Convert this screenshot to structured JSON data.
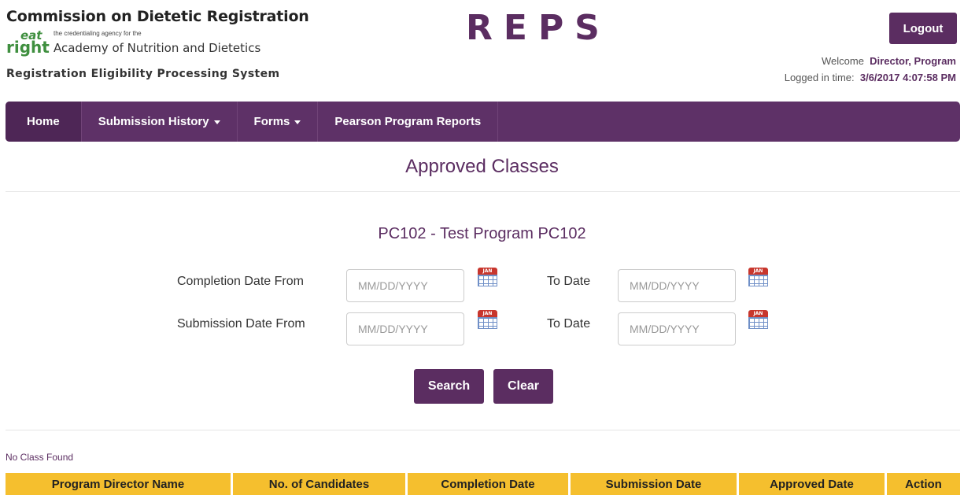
{
  "header": {
    "org_title": "Commission on Dietetic Registration",
    "logo": {
      "eat": "eat",
      "right": "right",
      "tagline": "the credentialing agency for the",
      "academy": "Academy of Nutrition and Dietetics"
    },
    "system_name": "Registration Eligibility Processing System",
    "app_title": "REPS",
    "logout_label": "Logout",
    "welcome_prefix": "Welcome",
    "user_name": "Director, Program",
    "logged_prefix": "Logged in time:",
    "logged_time": "3/6/2017 4:07:58 PM"
  },
  "nav": {
    "items": [
      {
        "label": "Home"
      },
      {
        "label": "Submission History"
      },
      {
        "label": "Forms"
      },
      {
        "label": "Pearson Program Reports"
      }
    ]
  },
  "page": {
    "title": "Approved Classes",
    "program": "PC102 - Test Program PC102"
  },
  "filters": {
    "completion_from_label": "Completion Date From",
    "submission_from_label": "Submission Date From",
    "to_label": "To Date",
    "date_placeholder": "MM/DD/YYYY",
    "calendar_text": "JAN",
    "search_label": "Search",
    "clear_label": "Clear"
  },
  "results": {
    "message": "No Class Found",
    "columns": [
      "Program Director Name",
      "No. of Candidates",
      "Completion Date",
      "Submission Date",
      "Approved Date",
      "Action"
    ]
  },
  "colors": {
    "brand": "#5b2d61",
    "nav_bg": "#5e3167",
    "table_header": "#f5bf2e"
  },
  "icons": [
    "calendar-icon",
    "caret-down-icon"
  ]
}
